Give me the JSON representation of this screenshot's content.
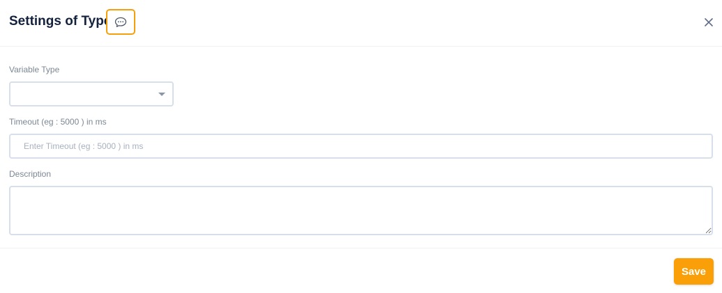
{
  "header": {
    "title": "Settings of Type",
    "comment_icon": "chat-bubble-icon",
    "close_icon": "close-icon"
  },
  "form": {
    "variable_type": {
      "label": "Variable Type",
      "value": ""
    },
    "timeout": {
      "label": "Timeout (eg : 5000 ) in ms",
      "placeholder": "Enter Timeout (eg : 5000 ) in ms",
      "value": ""
    },
    "description": {
      "label": "Description",
      "value": ""
    }
  },
  "footer": {
    "save_label": "Save"
  },
  "colors": {
    "accent": "#fb9f08",
    "title": "#14213d",
    "label": "#7b8794",
    "border": "#d7dfea"
  }
}
